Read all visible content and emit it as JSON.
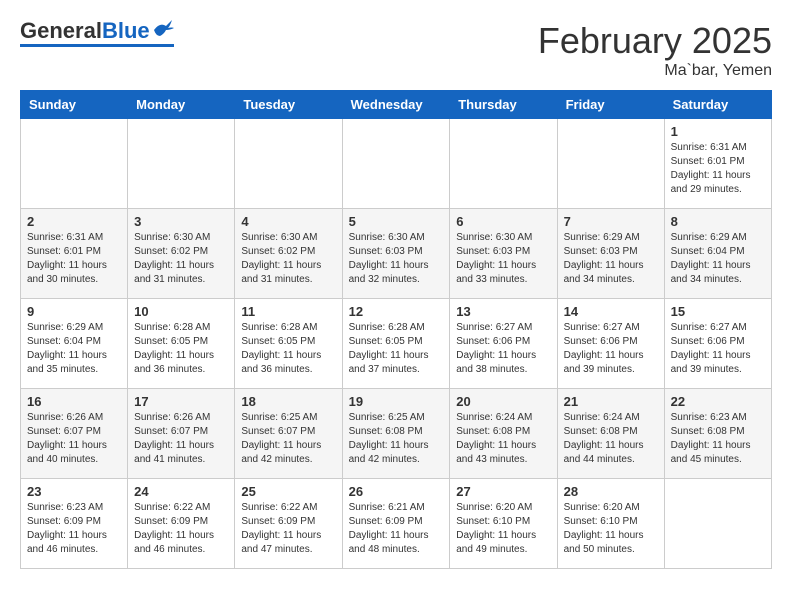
{
  "header": {
    "logo_general": "General",
    "logo_blue": "Blue",
    "month_title": "February 2025",
    "location": "Ma`bar, Yemen"
  },
  "weekdays": [
    "Sunday",
    "Monday",
    "Tuesday",
    "Wednesday",
    "Thursday",
    "Friday",
    "Saturday"
  ],
  "weeks": [
    [
      {
        "day": "",
        "info": ""
      },
      {
        "day": "",
        "info": ""
      },
      {
        "day": "",
        "info": ""
      },
      {
        "day": "",
        "info": ""
      },
      {
        "day": "",
        "info": ""
      },
      {
        "day": "",
        "info": ""
      },
      {
        "day": "1",
        "info": "Sunrise: 6:31 AM\nSunset: 6:01 PM\nDaylight: 11 hours and 29 minutes."
      }
    ],
    [
      {
        "day": "2",
        "info": "Sunrise: 6:31 AM\nSunset: 6:01 PM\nDaylight: 11 hours and 30 minutes."
      },
      {
        "day": "3",
        "info": "Sunrise: 6:30 AM\nSunset: 6:02 PM\nDaylight: 11 hours and 31 minutes."
      },
      {
        "day": "4",
        "info": "Sunrise: 6:30 AM\nSunset: 6:02 PM\nDaylight: 11 hours and 31 minutes."
      },
      {
        "day": "5",
        "info": "Sunrise: 6:30 AM\nSunset: 6:03 PM\nDaylight: 11 hours and 32 minutes."
      },
      {
        "day": "6",
        "info": "Sunrise: 6:30 AM\nSunset: 6:03 PM\nDaylight: 11 hours and 33 minutes."
      },
      {
        "day": "7",
        "info": "Sunrise: 6:29 AM\nSunset: 6:03 PM\nDaylight: 11 hours and 34 minutes."
      },
      {
        "day": "8",
        "info": "Sunrise: 6:29 AM\nSunset: 6:04 PM\nDaylight: 11 hours and 34 minutes."
      }
    ],
    [
      {
        "day": "9",
        "info": "Sunrise: 6:29 AM\nSunset: 6:04 PM\nDaylight: 11 hours and 35 minutes."
      },
      {
        "day": "10",
        "info": "Sunrise: 6:28 AM\nSunset: 6:05 PM\nDaylight: 11 hours and 36 minutes."
      },
      {
        "day": "11",
        "info": "Sunrise: 6:28 AM\nSunset: 6:05 PM\nDaylight: 11 hours and 36 minutes."
      },
      {
        "day": "12",
        "info": "Sunrise: 6:28 AM\nSunset: 6:05 PM\nDaylight: 11 hours and 37 minutes."
      },
      {
        "day": "13",
        "info": "Sunrise: 6:27 AM\nSunset: 6:06 PM\nDaylight: 11 hours and 38 minutes."
      },
      {
        "day": "14",
        "info": "Sunrise: 6:27 AM\nSunset: 6:06 PM\nDaylight: 11 hours and 39 minutes."
      },
      {
        "day": "15",
        "info": "Sunrise: 6:27 AM\nSunset: 6:06 PM\nDaylight: 11 hours and 39 minutes."
      }
    ],
    [
      {
        "day": "16",
        "info": "Sunrise: 6:26 AM\nSunset: 6:07 PM\nDaylight: 11 hours and 40 minutes."
      },
      {
        "day": "17",
        "info": "Sunrise: 6:26 AM\nSunset: 6:07 PM\nDaylight: 11 hours and 41 minutes."
      },
      {
        "day": "18",
        "info": "Sunrise: 6:25 AM\nSunset: 6:07 PM\nDaylight: 11 hours and 42 minutes."
      },
      {
        "day": "19",
        "info": "Sunrise: 6:25 AM\nSunset: 6:08 PM\nDaylight: 11 hours and 42 minutes."
      },
      {
        "day": "20",
        "info": "Sunrise: 6:24 AM\nSunset: 6:08 PM\nDaylight: 11 hours and 43 minutes."
      },
      {
        "day": "21",
        "info": "Sunrise: 6:24 AM\nSunset: 6:08 PM\nDaylight: 11 hours and 44 minutes."
      },
      {
        "day": "22",
        "info": "Sunrise: 6:23 AM\nSunset: 6:08 PM\nDaylight: 11 hours and 45 minutes."
      }
    ],
    [
      {
        "day": "23",
        "info": "Sunrise: 6:23 AM\nSunset: 6:09 PM\nDaylight: 11 hours and 46 minutes."
      },
      {
        "day": "24",
        "info": "Sunrise: 6:22 AM\nSunset: 6:09 PM\nDaylight: 11 hours and 46 minutes."
      },
      {
        "day": "25",
        "info": "Sunrise: 6:22 AM\nSunset: 6:09 PM\nDaylight: 11 hours and 47 minutes."
      },
      {
        "day": "26",
        "info": "Sunrise: 6:21 AM\nSunset: 6:09 PM\nDaylight: 11 hours and 48 minutes."
      },
      {
        "day": "27",
        "info": "Sunrise: 6:20 AM\nSunset: 6:10 PM\nDaylight: 11 hours and 49 minutes."
      },
      {
        "day": "28",
        "info": "Sunrise: 6:20 AM\nSunset: 6:10 PM\nDaylight: 11 hours and 50 minutes."
      },
      {
        "day": "",
        "info": ""
      }
    ]
  ]
}
